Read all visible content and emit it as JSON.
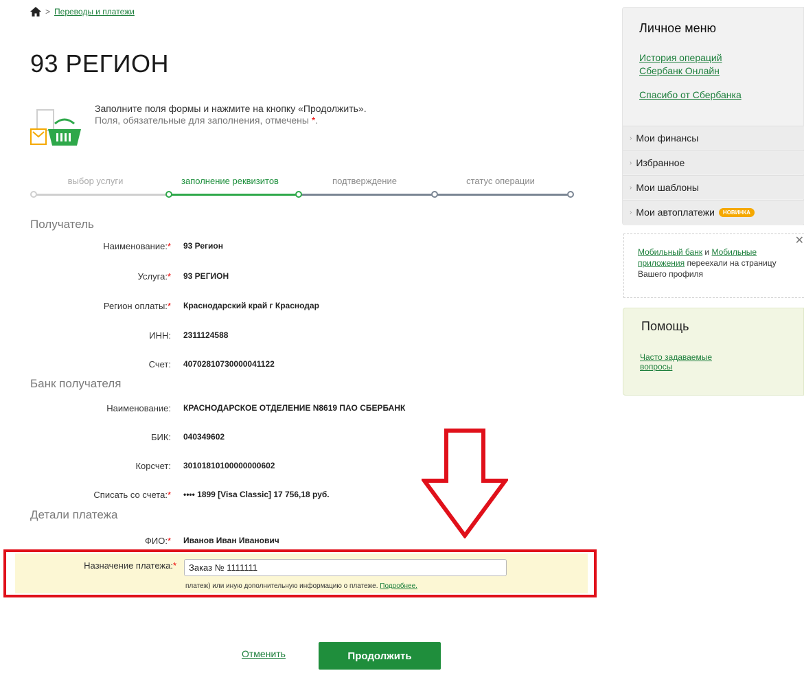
{
  "breadcrumb": {
    "home_icon": "home-icon",
    "link": "Переводы и платежи"
  },
  "page": {
    "title": "93 РЕГИОН"
  },
  "intro": {
    "line1": "Заполните поля формы и нажмите на кнопку «Продолжить».",
    "line2": "Поля, обязательные для заполнения, отмечены",
    "required_mark": "*",
    "line2_end": "."
  },
  "steps": [
    {
      "label": "выбор услуги",
      "state": "done"
    },
    {
      "label": "заполнение реквизитов",
      "state": "active"
    },
    {
      "label": "подтверждение",
      "state": "pending"
    },
    {
      "label": "статус операции",
      "state": "pending"
    }
  ],
  "recipient": {
    "title": "Получатель",
    "rows": [
      {
        "label": "Наименование:",
        "required": true,
        "value": "93 Регион"
      },
      {
        "label": "Услуга:",
        "required": true,
        "value": "93 РЕГИОН"
      },
      {
        "label": "Регион оплаты:",
        "required": true,
        "value": "Краснодарский край г Краснодар"
      },
      {
        "label": "ИНН:",
        "required": false,
        "value": "2311124588"
      },
      {
        "label": "Счет:",
        "required": false,
        "value": "40702810730000041122"
      }
    ]
  },
  "bank": {
    "title": "Банк получателя",
    "rows": [
      {
        "label": "Наименование:",
        "required": false,
        "value": "КРАСНОДАРСКОЕ ОТДЕЛЕНИЕ N8619 ПАО СБЕРБАНК"
      },
      {
        "label": "БИК:",
        "required": false,
        "value": "040349602"
      },
      {
        "label": "Корсчет:",
        "required": false,
        "value": "30101810100000000602"
      },
      {
        "label": "Списать со счета:",
        "required": true,
        "value": "•••• 1899  [Visa Classic] 17 756,18   руб."
      }
    ]
  },
  "details": {
    "title": "Детали платежа",
    "fio_label": "ФИО:",
    "fio_value": "Иванов Иван Иванович",
    "purpose_label": "Назначение платежа:",
    "purpose_value": "Заказ № 1111111",
    "purpose_hint": "платеж) или иную дополнительную информацию о платеже.",
    "purpose_more": "Подробнее."
  },
  "actions": {
    "cancel": "Отменить",
    "continue": "Продолжить"
  },
  "sidebar": {
    "title": "Личное меню",
    "link_history_1": "История операций",
    "link_history_2": "Сбербанк Онлайн",
    "link_thanks": "Спасибо от Сбербанка",
    "items": [
      {
        "label": "Мои финансы"
      },
      {
        "label": "Избранное"
      },
      {
        "label": "Мои шаблоны"
      },
      {
        "label": "Мои автоплатежи",
        "badge": "новинка"
      }
    ]
  },
  "notice": {
    "link1": "Мобильный банк",
    "and": "и",
    "link2": "Мобильные приложения",
    "text": "переехали на страницу Вашего профиля"
  },
  "help": {
    "title": "Помощь",
    "faq": "Часто задаваемые вопросы"
  },
  "colors": {
    "accent": "#1f8e3c",
    "highlight_border": "#e0101a",
    "highlight_bg": "#fcf7d4",
    "badge": "#f5a800"
  }
}
